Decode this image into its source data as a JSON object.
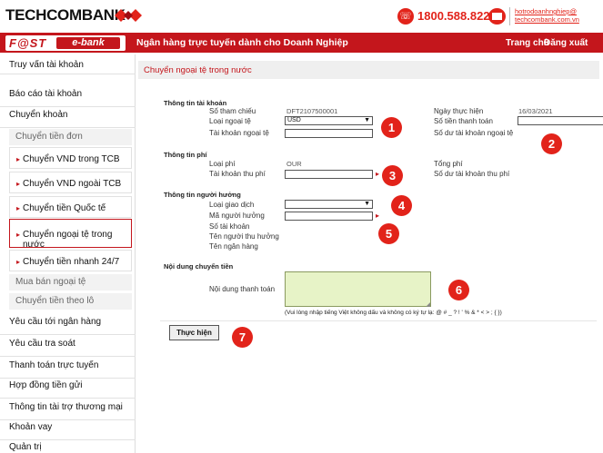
{
  "header": {
    "bank_name": "TECHCOMBANK",
    "hotline": "1800.588.822",
    "emails": [
      "hotrodoanhnghiep@",
      "techcombank.com.vn"
    ]
  },
  "nav": {
    "logo_part1": "F@ST",
    "logo_part2": "e-bank",
    "title": "Ngân hàng trực tuyến dành cho Doanh Nghiệp",
    "home": "Trang chủ",
    "logout": "Đăng xuất"
  },
  "sidebar": {
    "items": [
      "Truy vấn tài khoản",
      "Báo cáo tài khoản",
      "Chuyển khoản",
      "Chuyển tiền đơn",
      "Chuyển VND trong TCB",
      "Chuyển VND ngoài TCB",
      "Chuyển tiền Quốc tế",
      "Chuyển ngoại tệ trong nước",
      "Chuyển tiền nhanh 24/7",
      "Mua bán ngoại tệ",
      "Chuyển tiền theo lô",
      "Yêu cầu tới ngân hàng",
      "Yêu cầu tra soát",
      "Thanh toán trực tuyến",
      "Hợp đồng tiền gửi",
      "Thông tin tài trợ thương mại",
      "Khoản vay",
      "Quản trị"
    ]
  },
  "page": {
    "title": "Chuyển ngoại tệ trong nước",
    "account_section": "Thông tin tài khoản",
    "ref_label": "Số tham chiếu",
    "ref_value": "DFT2107500001",
    "currency_label": "Loại ngoại tệ",
    "currency_value": "USD",
    "fx_account_label": "Tài khoản ngoại tệ",
    "date_label": "Ngày thực hiện",
    "date_value": "16/03/2021",
    "amount_label": "Số tiền thanh toán",
    "balance_label": "Số dư tài khoản ngoại tệ",
    "fee_section": "Thông tin phí",
    "fee_type_label": "Loại phí",
    "fee_type_value": "OUR",
    "fee_account_label": "Tài khoản thu phí",
    "total_fee_label": "Tổng phí",
    "fee_balance_label": "Số dư tài khoản thu phí",
    "beneficiary_section": "Thông tin người hưởng",
    "txn_type_label": "Loại giao dịch",
    "beneficiary_code_label": "Mã người hưởng",
    "account_no_label": "Số tài khoản",
    "receiver_name_label": "Tên người thu hưởng",
    "bank_name_label": "Tên ngân hàng",
    "content_section": "Nội dung chuyển tiền",
    "payment_content_label": "Nội dung thanh toán",
    "note": "(Vui lòng nhập tiếng Việt không dấu và không có ký tự lạ: @ # _ ? ! ' % & * < > ; { })",
    "submit": "Thực hiện"
  },
  "badges": [
    "1",
    "2",
    "3",
    "4",
    "5",
    "6",
    "7"
  ],
  "colors": {
    "brand_red": "#c4161c",
    "badge_red": "#e2231a",
    "textarea_bg": "#e7f3c7"
  }
}
